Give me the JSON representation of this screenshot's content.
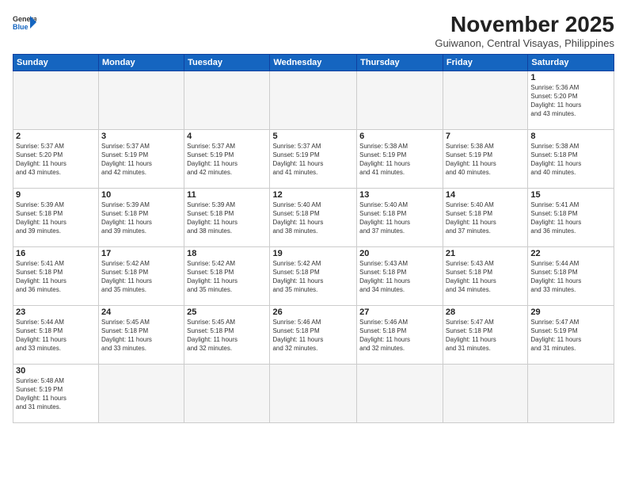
{
  "header": {
    "logo_line1": "General",
    "logo_line2": "Blue",
    "title": "November 2025",
    "subtitle": "Guiwanon, Central Visayas, Philippines"
  },
  "weekdays": [
    "Sunday",
    "Monday",
    "Tuesday",
    "Wednesday",
    "Thursday",
    "Friday",
    "Saturday"
  ],
  "weeks": [
    [
      {
        "day": "",
        "text": ""
      },
      {
        "day": "",
        "text": ""
      },
      {
        "day": "",
        "text": ""
      },
      {
        "day": "",
        "text": ""
      },
      {
        "day": "",
        "text": ""
      },
      {
        "day": "",
        "text": ""
      },
      {
        "day": "1",
        "text": "Sunrise: 5:36 AM\nSunset: 5:20 PM\nDaylight: 11 hours\nand 43 minutes."
      }
    ],
    [
      {
        "day": "2",
        "text": "Sunrise: 5:37 AM\nSunset: 5:20 PM\nDaylight: 11 hours\nand 43 minutes."
      },
      {
        "day": "3",
        "text": "Sunrise: 5:37 AM\nSunset: 5:19 PM\nDaylight: 11 hours\nand 42 minutes."
      },
      {
        "day": "4",
        "text": "Sunrise: 5:37 AM\nSunset: 5:19 PM\nDaylight: 11 hours\nand 42 minutes."
      },
      {
        "day": "5",
        "text": "Sunrise: 5:37 AM\nSunset: 5:19 PM\nDaylight: 11 hours\nand 41 minutes."
      },
      {
        "day": "6",
        "text": "Sunrise: 5:38 AM\nSunset: 5:19 PM\nDaylight: 11 hours\nand 41 minutes."
      },
      {
        "day": "7",
        "text": "Sunrise: 5:38 AM\nSunset: 5:19 PM\nDaylight: 11 hours\nand 40 minutes."
      },
      {
        "day": "8",
        "text": "Sunrise: 5:38 AM\nSunset: 5:18 PM\nDaylight: 11 hours\nand 40 minutes."
      }
    ],
    [
      {
        "day": "9",
        "text": "Sunrise: 5:39 AM\nSunset: 5:18 PM\nDaylight: 11 hours\nand 39 minutes."
      },
      {
        "day": "10",
        "text": "Sunrise: 5:39 AM\nSunset: 5:18 PM\nDaylight: 11 hours\nand 39 minutes."
      },
      {
        "day": "11",
        "text": "Sunrise: 5:39 AM\nSunset: 5:18 PM\nDaylight: 11 hours\nand 38 minutes."
      },
      {
        "day": "12",
        "text": "Sunrise: 5:40 AM\nSunset: 5:18 PM\nDaylight: 11 hours\nand 38 minutes."
      },
      {
        "day": "13",
        "text": "Sunrise: 5:40 AM\nSunset: 5:18 PM\nDaylight: 11 hours\nand 37 minutes."
      },
      {
        "day": "14",
        "text": "Sunrise: 5:40 AM\nSunset: 5:18 PM\nDaylight: 11 hours\nand 37 minutes."
      },
      {
        "day": "15",
        "text": "Sunrise: 5:41 AM\nSunset: 5:18 PM\nDaylight: 11 hours\nand 36 minutes."
      }
    ],
    [
      {
        "day": "16",
        "text": "Sunrise: 5:41 AM\nSunset: 5:18 PM\nDaylight: 11 hours\nand 36 minutes."
      },
      {
        "day": "17",
        "text": "Sunrise: 5:42 AM\nSunset: 5:18 PM\nDaylight: 11 hours\nand 35 minutes."
      },
      {
        "day": "18",
        "text": "Sunrise: 5:42 AM\nSunset: 5:18 PM\nDaylight: 11 hours\nand 35 minutes."
      },
      {
        "day": "19",
        "text": "Sunrise: 5:42 AM\nSunset: 5:18 PM\nDaylight: 11 hours\nand 35 minutes."
      },
      {
        "day": "20",
        "text": "Sunrise: 5:43 AM\nSunset: 5:18 PM\nDaylight: 11 hours\nand 34 minutes."
      },
      {
        "day": "21",
        "text": "Sunrise: 5:43 AM\nSunset: 5:18 PM\nDaylight: 11 hours\nand 34 minutes."
      },
      {
        "day": "22",
        "text": "Sunrise: 5:44 AM\nSunset: 5:18 PM\nDaylight: 11 hours\nand 33 minutes."
      }
    ],
    [
      {
        "day": "23",
        "text": "Sunrise: 5:44 AM\nSunset: 5:18 PM\nDaylight: 11 hours\nand 33 minutes."
      },
      {
        "day": "24",
        "text": "Sunrise: 5:45 AM\nSunset: 5:18 PM\nDaylight: 11 hours\nand 33 minutes."
      },
      {
        "day": "25",
        "text": "Sunrise: 5:45 AM\nSunset: 5:18 PM\nDaylight: 11 hours\nand 32 minutes."
      },
      {
        "day": "26",
        "text": "Sunrise: 5:46 AM\nSunset: 5:18 PM\nDaylight: 11 hours\nand 32 minutes."
      },
      {
        "day": "27",
        "text": "Sunrise: 5:46 AM\nSunset: 5:18 PM\nDaylight: 11 hours\nand 32 minutes."
      },
      {
        "day": "28",
        "text": "Sunrise: 5:47 AM\nSunset: 5:18 PM\nDaylight: 11 hours\nand 31 minutes."
      },
      {
        "day": "29",
        "text": "Sunrise: 5:47 AM\nSunset: 5:19 PM\nDaylight: 11 hours\nand 31 minutes."
      }
    ],
    [
      {
        "day": "30",
        "text": "Sunrise: 5:48 AM\nSunset: 5:19 PM\nDaylight: 11 hours\nand 31 minutes."
      },
      {
        "day": "",
        "text": ""
      },
      {
        "day": "",
        "text": ""
      },
      {
        "day": "",
        "text": ""
      },
      {
        "day": "",
        "text": ""
      },
      {
        "day": "",
        "text": ""
      },
      {
        "day": "",
        "text": ""
      }
    ]
  ]
}
